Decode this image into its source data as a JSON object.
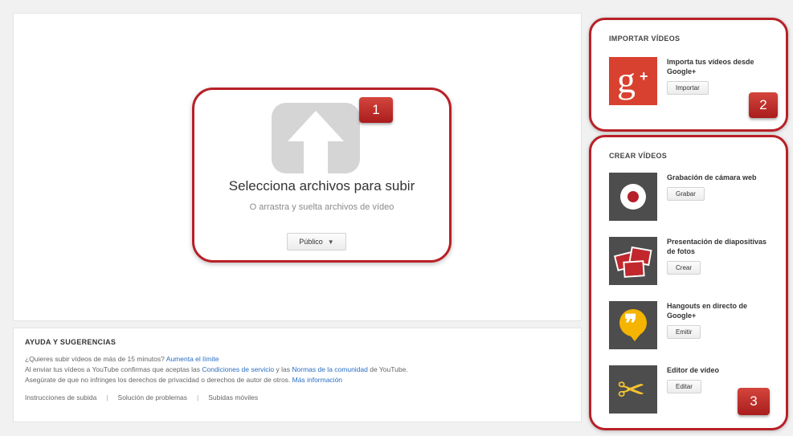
{
  "upload": {
    "title": "Selecciona archivos para subir",
    "subtitle": "O arrastra y suelta archivos de vídeo",
    "privacy_value": "Público",
    "privacy_caret": "▼",
    "badge": "1"
  },
  "help": {
    "title": "AYUDA Y SUGERENCIAS",
    "line1_text": "¿Quieres subir vídeos de más de 15 minutos?",
    "line1_link": "Aumenta el límite",
    "line2_prefix": "Al enviar tus vídeos a YouTube confirmas que aceptas las",
    "line2_link1": "Condiciones de servicio",
    "line2_mid": "y las",
    "line2_link2": "Normas de la comunidad",
    "line2_suffix": "de YouTube.",
    "line3_text": "Asegúrate de que no infringes los derechos de privacidad o derechos de autor de otros.",
    "line3_link": "Más información",
    "links": [
      "Instrucciones de subida",
      "Solución de problemas",
      "Subidas móviles"
    ],
    "separator": "|"
  },
  "import": {
    "heading": "IMPORTAR VÍDEOS",
    "label": "Importa tus vídeos desde Google+",
    "button": "Importar",
    "badge": "2",
    "icon_glyph": "g",
    "icon_plus": "+"
  },
  "create": {
    "heading": "CREAR VÍDEOS",
    "badge": "3",
    "tools": [
      {
        "label": "Grabación de cámara web",
        "button": "Grabar"
      },
      {
        "label": "Presentación de diapositivas de fotos",
        "button": "Crear"
      },
      {
        "label": "Hangouts en directo de Google+",
        "button": "Emitir"
      },
      {
        "label": "Editor de vídeo",
        "button": "Editar"
      }
    ],
    "hangout_glyph": "❞",
    "scissors_glyph": "✂"
  },
  "colors": {
    "accent_red": "#b82027",
    "link_blue": "#2a6ec2",
    "upload_arrow_gray": "#d5d5d5"
  }
}
